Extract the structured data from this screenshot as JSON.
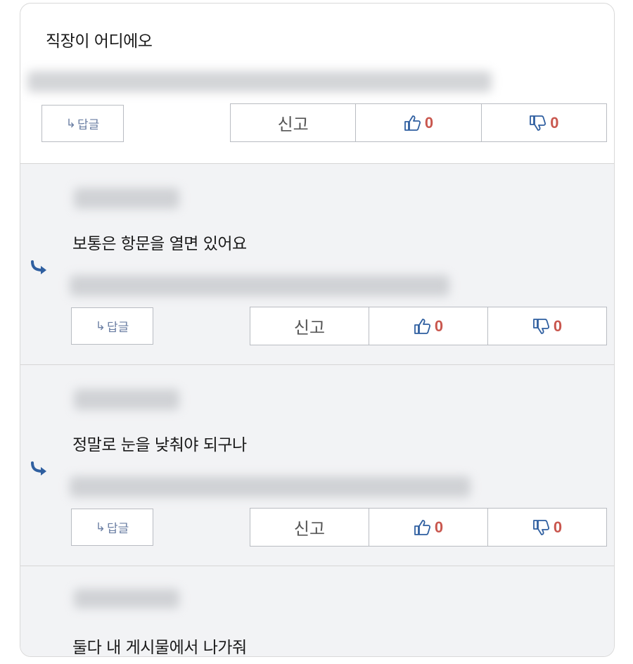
{
  "comments": [
    {
      "text": "직장이 어디에오",
      "reply_label": "답글",
      "report_label": "신고",
      "like_count": "0",
      "dislike_count": "0"
    },
    {
      "text": "보통은 항문을 열면 있어요",
      "reply_label": "답글",
      "report_label": "신고",
      "like_count": "0",
      "dislike_count": "0"
    },
    {
      "text": "정말로 눈을 낮춰야 되구나",
      "reply_label": "답글",
      "report_label": "신고",
      "like_count": "0",
      "dislike_count": "0"
    },
    {
      "text": "둘다 내 게시물에서 나가줘"
    }
  ],
  "icons": {
    "reply_arrow": "reply-arrow-icon",
    "thumbs_up": "thumbs-up-icon",
    "thumbs_down": "thumbs-down-icon"
  },
  "colors": {
    "accent_blue": "#2f5fa0",
    "count_red": "#c9574e",
    "reply_background": "#f2f3f5"
  }
}
